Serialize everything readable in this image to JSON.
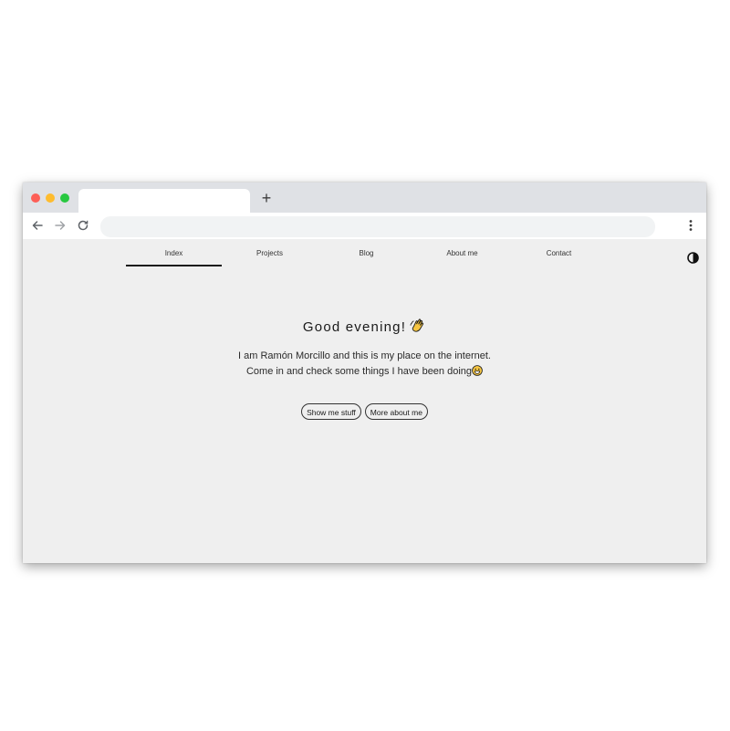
{
  "browser": {
    "traffic_lights": [
      "close",
      "minimize",
      "maximize"
    ],
    "new_tab_label": "+",
    "address_value": ""
  },
  "site": {
    "nav": [
      {
        "label": "Index",
        "active": true
      },
      {
        "label": "Projects",
        "active": false
      },
      {
        "label": "Blog",
        "active": false
      },
      {
        "label": "About me",
        "active": false
      },
      {
        "label": "Contact",
        "active": false
      }
    ],
    "greeting": "Good evening!",
    "greeting_icon": "waving-hand-icon",
    "intro_line1": "I am Ramón Morcillo and this is my place on the internet.",
    "intro_line2": "Come in and check some things I have been doing",
    "intro_icon": "grinning-face-icon",
    "buttons": {
      "primary": "Show me stuff",
      "secondary": "More about me"
    },
    "theme_toggle_icon": "contrast-icon"
  }
}
